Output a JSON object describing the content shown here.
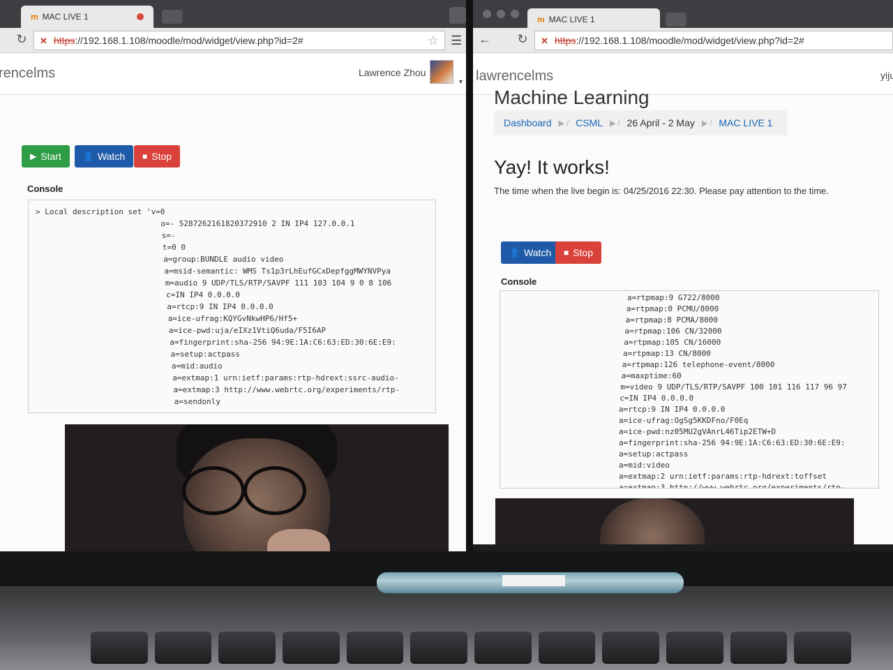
{
  "left": {
    "tab_title": "MAC LIVE 1",
    "url_scheme": "https",
    "url_rest": "://192.168.1.108/moodle/mod/widget/view.php?id=2#",
    "brand": "rencelms",
    "user_name": "Lawrence Zhou",
    "buttons": {
      "start": "Start",
      "watch": "Watch",
      "stop": "Stop"
    },
    "console_label": "Console",
    "console_lines": [
      "> Local description set 'v=0",
      "o=- 5287262161820372910 2 IN IP4 127.0.0.1",
      "s=-",
      "t=0 0",
      "a=group:BUNDLE audio video",
      "a=msid-semantic: WMS Ts1p3rLhEufGCxDepfggMWYNVPya",
      "m=audio 9 UDP/TLS/RTP/SAVPF 111 103 104 9 0 8 106",
      "c=IN IP4 0.0.0.0",
      "a=rtcp:9 IN IP4 0.0.0.0",
      "a=ice-ufrag:KQYGvNkwHP6/Hf5+",
      "a=ice-pwd:uja/eIXz1VtiQ6uda/F5I6AP",
      "a=fingerprint:sha-256 94:9E:1A:C6:63:ED:30:6E:E9:",
      "a=setup:actpass",
      "a=mid:audio",
      "a=extmap:1 urn:ietf:params:rtp-hdrext:ssrc-audio-",
      "a=extmap:3 http://www.webrtc.org/experiments/rtp-",
      "a=sendonly"
    ]
  },
  "right": {
    "tab_title": "MAC LIVE 1",
    "url_scheme": "https",
    "url_rest": "://192.168.1.108/moodle/mod/widget/view.php?id=2#",
    "brand": "lawrencelms",
    "user_name": "yiju",
    "partial_title": "Machine Learning",
    "breadcrumb": [
      "Dashboard",
      "CSML",
      "26 April - 2 May",
      "MAC LIVE 1"
    ],
    "heading": "Yay! It works!",
    "notice": "The time when the live begin is: 04/25/2016 22:30. Please pay attention to the time.",
    "buttons": {
      "watch": "Watch",
      "stop": "Stop"
    },
    "console_label": "Console",
    "console_lines": [
      "a=rtpmap:9 G722/8000",
      "a=rtpmap:0 PCMU/8000",
      "a=rtpmap:8 PCMA/8000",
      "a=rtpmap:106 CN/32000",
      "a=rtpmap:105 CN/16000",
      "a=rtpmap:13 CN/8000",
      "a=rtpmap:126 telephone-event/8000",
      "a=maxptime:60",
      "m=video 9 UDP/TLS/RTP/SAVPF 100 101 116 117 96 97",
      "c=IN IP4 0.0.0.0",
      "a=rtcp:9 IN IP4 0.0.0.0",
      "a=ice-ufrag:OgSg5KKDFno/F0Eq",
      "a=ice-pwd:nz05MU2gVAnrL46Tip2ETW+D",
      "a=fingerprint:sha-256 94:9E:1A:C6:63:ED:30:6E:E9:",
      "a=setup:actpass",
      "a=mid:video",
      "a=extmap:2 urn:ietf:params:rtp-hdrext:toffset",
      "a=extmap:3 http://www.webrtc.org/experiments/rtp-"
    ]
  },
  "colors": {
    "start": "#2e9d45",
    "watch": "#1f5aa8",
    "stop": "#d9413a",
    "link": "#1a66b8"
  }
}
